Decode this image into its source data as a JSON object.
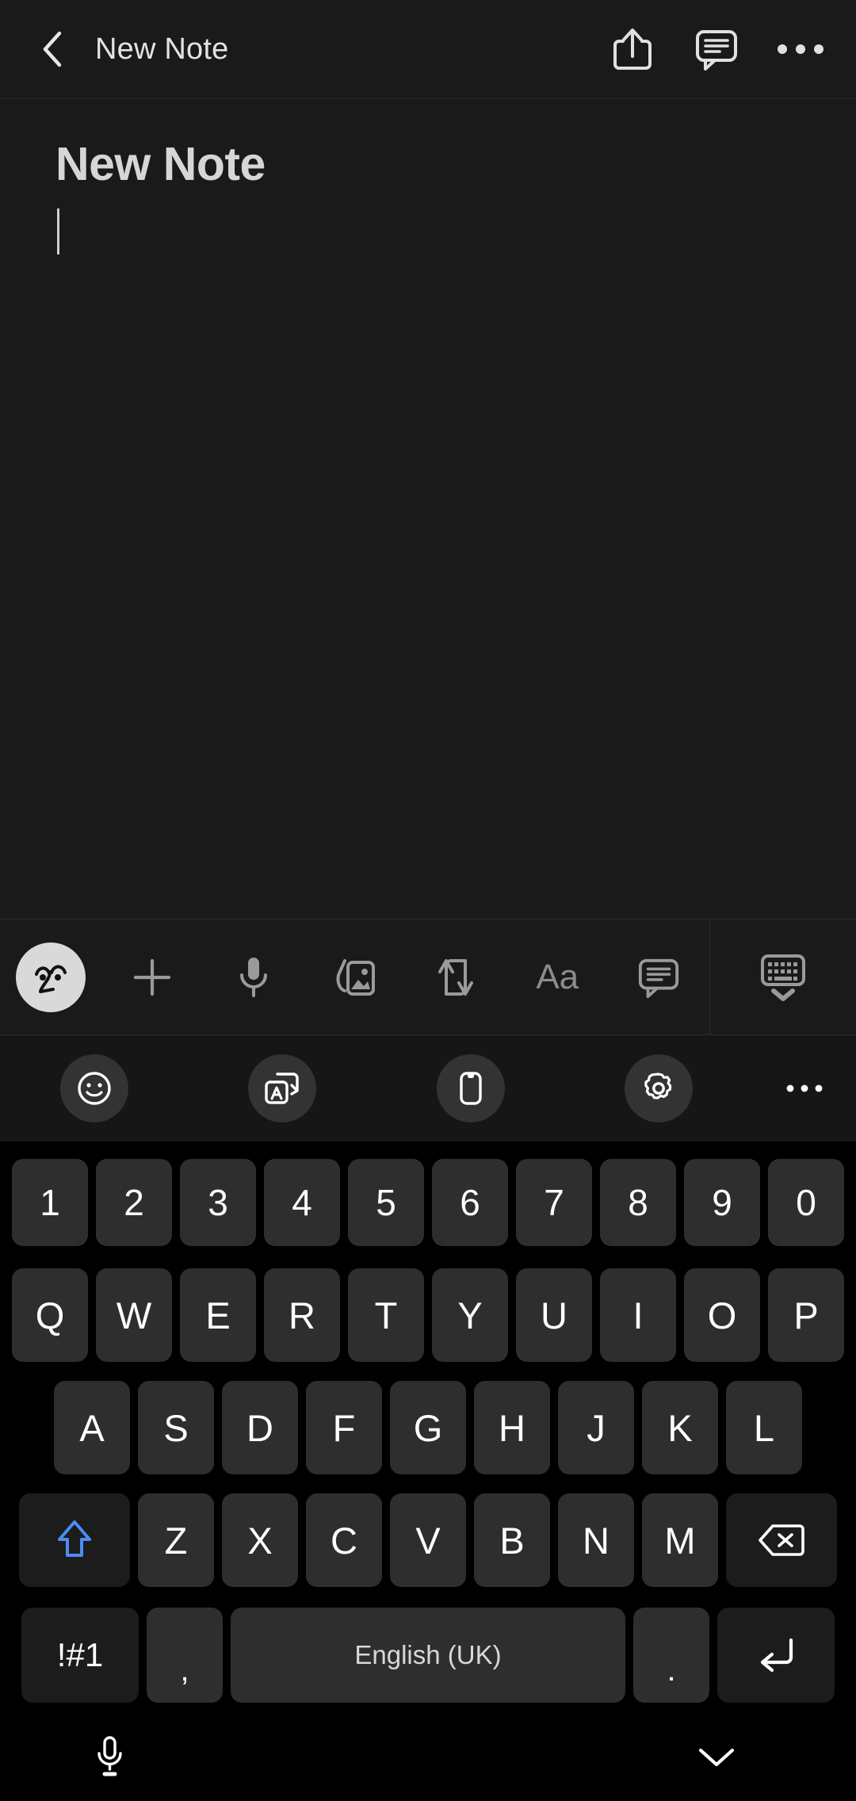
{
  "header": {
    "back_icon": "chevron-left-icon",
    "title": "New Note",
    "actions": [
      {
        "name": "share-icon",
        "label": "Share"
      },
      {
        "name": "comment-icon",
        "label": "Comment"
      },
      {
        "name": "more-options-icon",
        "label": "More options"
      }
    ]
  },
  "note": {
    "title": "New Note",
    "body": "",
    "caret_visible": true
  },
  "format_toolbar": {
    "items": [
      {
        "name": "handwriting-avatar-icon",
        "label": "Handwriting"
      },
      {
        "name": "add-icon",
        "label": "Insert"
      },
      {
        "name": "microphone-icon",
        "label": "Voice recording"
      },
      {
        "name": "image-icon",
        "label": "Images"
      },
      {
        "name": "convert-icon",
        "label": "Convert"
      },
      {
        "name": "text-format-icon",
        "label": "Aa"
      },
      {
        "name": "comment-icon",
        "label": "Comment"
      }
    ],
    "hide_keyboard": {
      "name": "keyboard-hide-icon",
      "label": "Hide keyboard"
    }
  },
  "keyboard_toolbar": {
    "items": [
      {
        "name": "emoji-icon",
        "label": "Emoji"
      },
      {
        "name": "translate-icon",
        "label": "Translate"
      },
      {
        "name": "clipboard-icon",
        "label": "Clipboard"
      },
      {
        "name": "settings-icon",
        "label": "Settings"
      }
    ],
    "more": {
      "name": "keyboard-more-icon",
      "label": "More"
    }
  },
  "keyboard": {
    "row_numbers": [
      "1",
      "2",
      "3",
      "4",
      "5",
      "6",
      "7",
      "8",
      "9",
      "0"
    ],
    "row_top": [
      "Q",
      "W",
      "E",
      "R",
      "T",
      "Y",
      "U",
      "I",
      "O",
      "P"
    ],
    "row_home": [
      "A",
      "S",
      "D",
      "F",
      "G",
      "H",
      "J",
      "K",
      "L"
    ],
    "row_bottom": [
      "Z",
      "X",
      "C",
      "V",
      "B",
      "N",
      "M"
    ],
    "shift": {
      "name": "shift-key",
      "label": "Shift",
      "state": "active",
      "color": "#4a8df5"
    },
    "backspace": {
      "name": "backspace-key",
      "label": "Backspace"
    },
    "symbols": {
      "name": "symbols-key",
      "label": "!#1"
    },
    "comma": {
      "name": "comma-key",
      "label": ","
    },
    "space": {
      "name": "space-key",
      "label": "English (UK)"
    },
    "period": {
      "name": "period-key",
      "label": "."
    },
    "enter": {
      "name": "enter-key",
      "label": "Enter"
    }
  },
  "system_bar": {
    "mic": {
      "name": "voice-input-icon",
      "label": "Voice input"
    },
    "hide": {
      "name": "chevron-down-icon",
      "label": "Hide keyboard"
    }
  },
  "colors": {
    "app_background": "#1a1a1a",
    "keyboard_background": "#000000",
    "key_fill": "#2e2e2e",
    "key_fill_dark": "#1c1c1c",
    "accent": "#4a8df5",
    "text_primary": "#ffffff",
    "text_secondary": "#8c8c8c"
  }
}
